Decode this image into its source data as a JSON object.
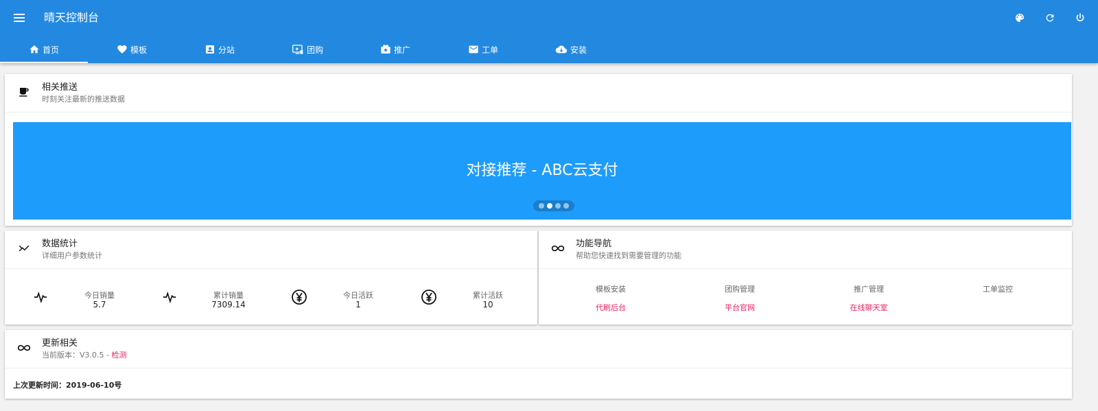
{
  "app": {
    "title": "晴天控制台"
  },
  "tabs": [
    {
      "label": "首页",
      "icon": "home-icon",
      "active": true
    },
    {
      "label": "模板",
      "icon": "heart-icon",
      "active": false
    },
    {
      "label": "分站",
      "icon": "contact-card-icon",
      "active": false
    },
    {
      "label": "团购",
      "icon": "group-buy-icon",
      "active": false
    },
    {
      "label": "推广",
      "icon": "promote-icon",
      "active": false
    },
    {
      "label": "工单",
      "icon": "mail-icon",
      "active": false
    },
    {
      "label": "安装",
      "icon": "cloud-download-icon",
      "active": false
    }
  ],
  "push": {
    "title": "相关推送",
    "subtitle": "时刻关注最新的推送数据",
    "banner_text": "对接推荐 - ABC云支付",
    "banner_color": "#1e9cfc",
    "active_slide": 2,
    "slide_count": 4
  },
  "stats": {
    "title": "数据统计",
    "subtitle": "详细用户参数统计",
    "items": [
      {
        "label": "今日销量",
        "value": "5.7",
        "icon": "pulse-icon"
      },
      {
        "label": "累计销量",
        "value": "7309.14",
        "icon": "pulse-icon"
      },
      {
        "label": "今日活跃",
        "value": "1",
        "icon": "yen-icon"
      },
      {
        "label": "累计活跃",
        "value": "10",
        "icon": "yen-icon"
      }
    ]
  },
  "nav": {
    "title": "功能导航",
    "subtitle": "帮助您快速找到需要管理的功能",
    "row1": [
      "模板安装",
      "团购管理",
      "推广管理",
      "工单监控"
    ],
    "row2": [
      "代刷后台",
      "平台官网",
      "在线聊天室"
    ]
  },
  "update": {
    "title": "更新相关",
    "version_prefix": "当前版本：V3.0.5 - ",
    "check_label": "检测",
    "last_update": "上次更新时间：2019-06-10号"
  },
  "colors": {
    "primary": "#2389e0",
    "accent_pink": "#e91e63"
  }
}
